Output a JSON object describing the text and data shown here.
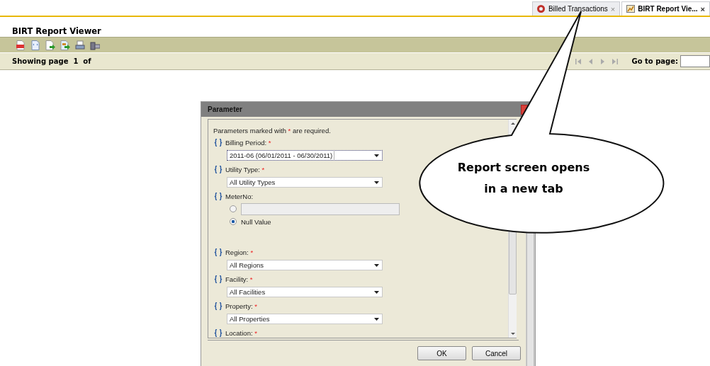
{
  "browser_tabs": [
    {
      "label": "Billed Transactions",
      "close": "×",
      "selected": false
    },
    {
      "label": "BIRT Report Vie...",
      "close": "×",
      "selected": true
    }
  ],
  "viewer": {
    "title": "BIRT Report Viewer",
    "status": "Showing page  1  of",
    "goto_label": "Go to page:"
  },
  "dialog": {
    "title": "Parameter",
    "note_before": "Parameters marked with",
    "note_mark": "*",
    "note_after": "are required.",
    "required_mark": "*",
    "parameters": [
      {
        "kind": "select",
        "label": "Billing Period:",
        "required": true,
        "value": "2011-06 (06/01/2011 - 06/30/2011)",
        "focused": true
      },
      {
        "kind": "select",
        "label": "Utility Type:",
        "required": true,
        "value": "All Utility Types",
        "focused": false
      },
      {
        "kind": "radio",
        "label": "MeterNo:",
        "required": false,
        "text_selected": false,
        "null_label": "Null Value",
        "null_selected": true
      },
      {
        "kind": "select",
        "label": "Region:",
        "required": true,
        "value": "All Regions",
        "focused": false
      },
      {
        "kind": "select",
        "label": "Facility:",
        "required": true,
        "value": "All Facilities",
        "focused": false
      },
      {
        "kind": "select",
        "label": "Property:",
        "required": true,
        "value": "All Properties",
        "focused": false
      },
      {
        "kind": "cut",
        "label": "Location:",
        "required": true
      }
    ],
    "buttons": [
      {
        "label": "OK"
      },
      {
        "label": "Cancel"
      }
    ]
  },
  "callout": {
    "lines": [
      "Report screen opens",
      "in a new tab"
    ]
  }
}
